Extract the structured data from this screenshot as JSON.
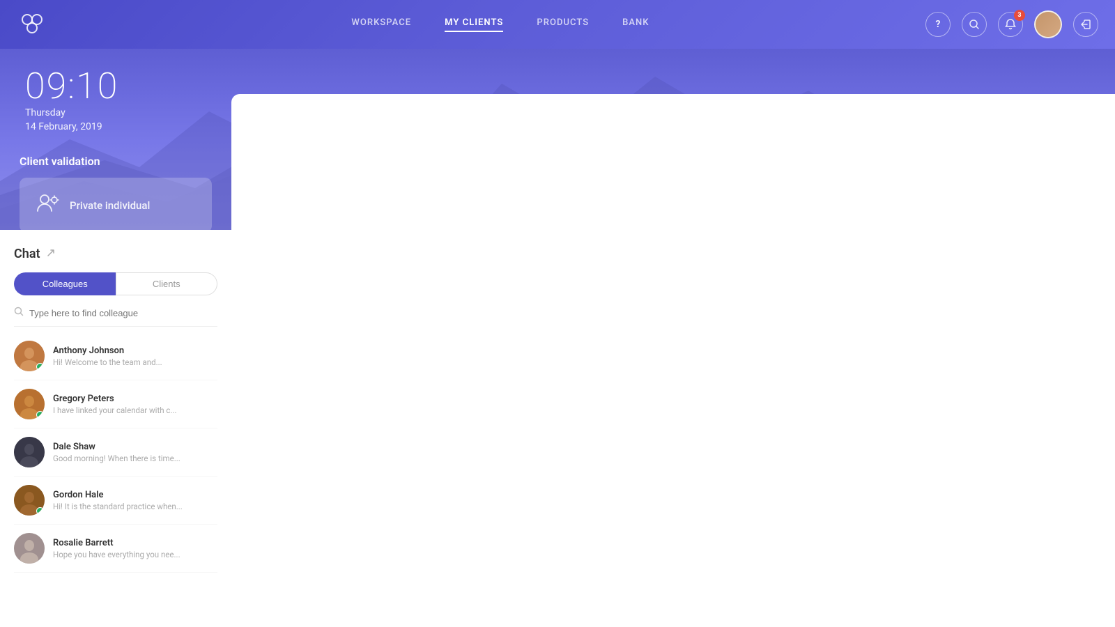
{
  "header": {
    "nav_items": [
      {
        "label": "WORKSPACE",
        "active": false
      },
      {
        "label": "MY CLIENTS",
        "active": true
      },
      {
        "label": "PRODUCTS",
        "active": false
      },
      {
        "label": "BANK",
        "active": false
      }
    ],
    "notification_count": "3",
    "help_label": "?",
    "search_label": "🔍"
  },
  "clock": {
    "time": "09:10",
    "day": "Thursday",
    "date": "14 February, 2019"
  },
  "client_validation": {
    "title": "Client validation",
    "card_label": "Private individual"
  },
  "chat": {
    "title": "Chat",
    "tab_colleagues": "Colleagues",
    "tab_clients": "Clients",
    "search_placeholder": "Type here to find colleague",
    "contacts": [
      {
        "name": "Anthony Johnson",
        "preview": "Hi! Welcome to the team and...",
        "online": true,
        "color": "av-aj"
      },
      {
        "name": "Gregory Peters",
        "preview": "I have linked your calendar with c...",
        "online": true,
        "color": "av-gp"
      },
      {
        "name": "Dale Shaw",
        "preview": "Good morning! When there is time...",
        "online": false,
        "color": "av-ds"
      },
      {
        "name": "Gordon Hale",
        "preview": "Hi! It is the standard practice when...",
        "online": true,
        "color": "av-gh"
      },
      {
        "name": "Rosalie Barrett",
        "preview": "Hope you have everything you nee...",
        "online": false,
        "color": "av-rb"
      }
    ]
  }
}
